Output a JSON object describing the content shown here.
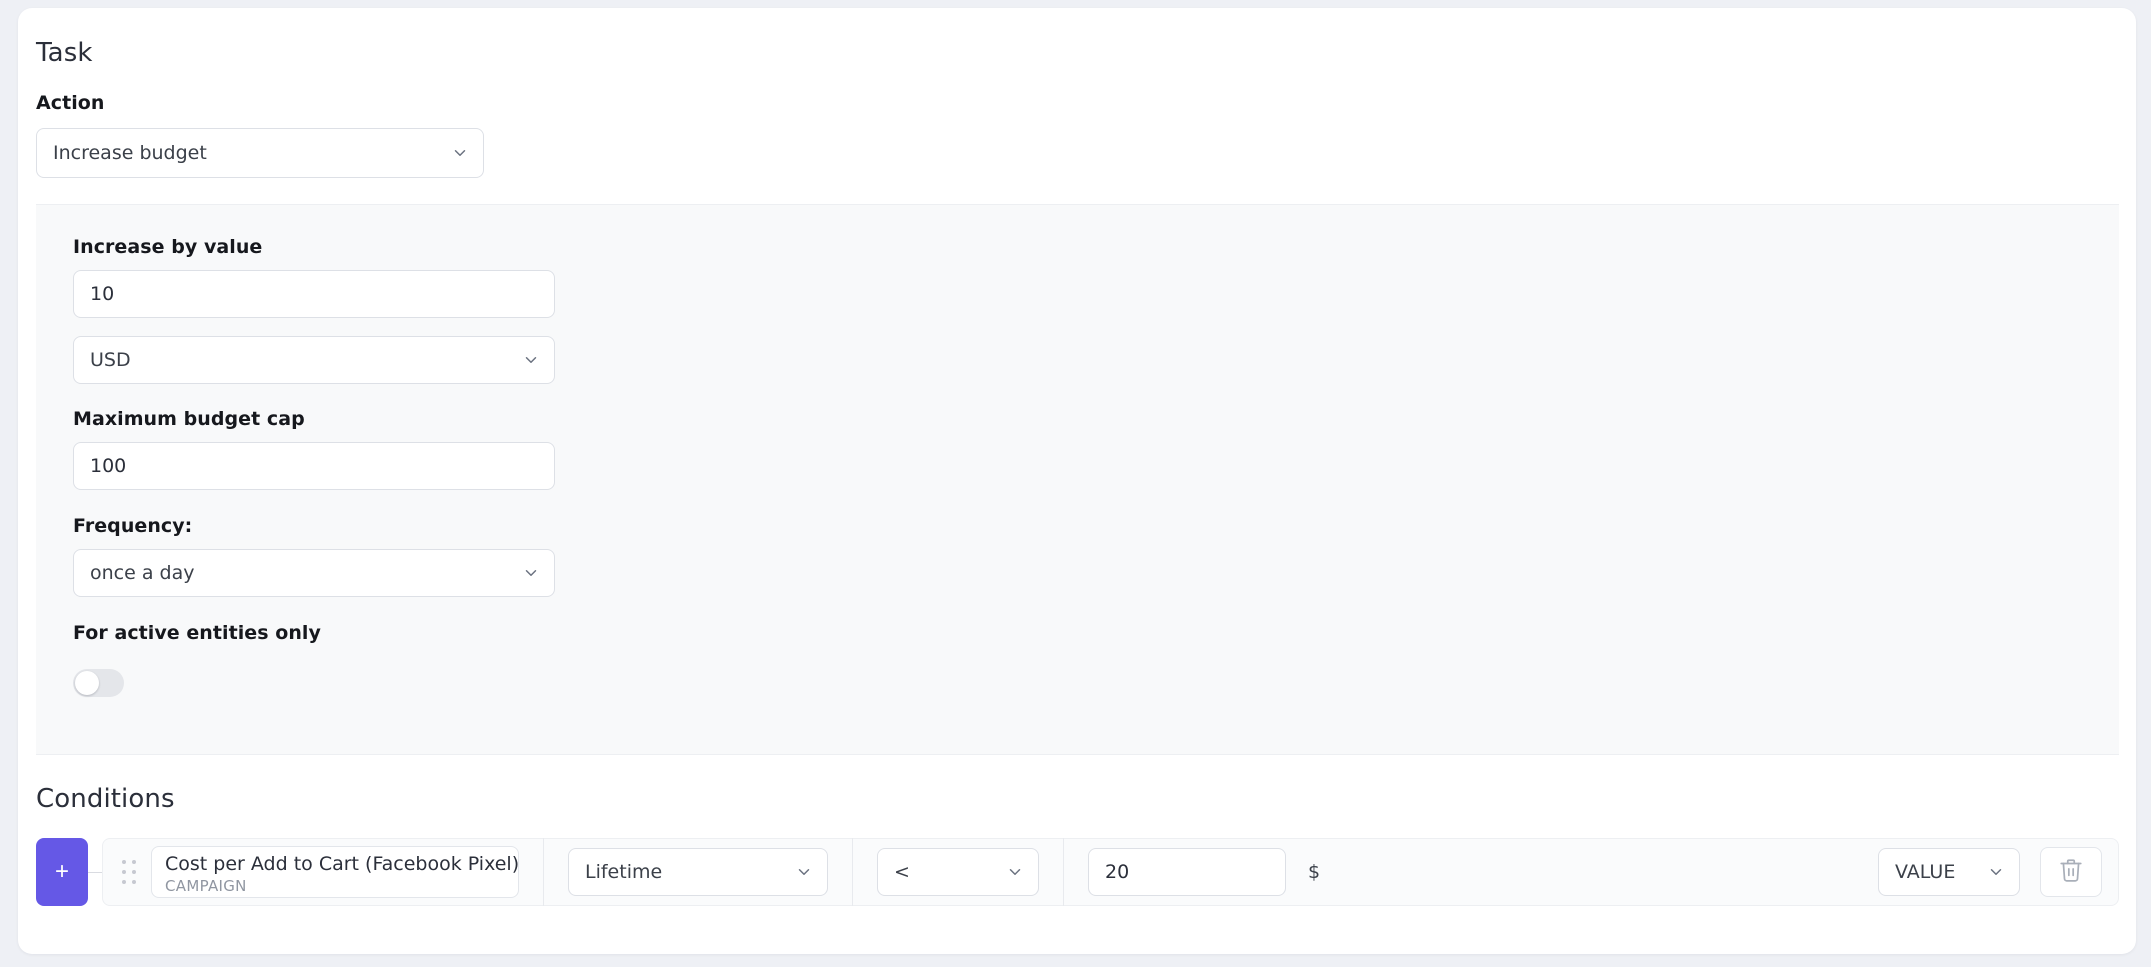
{
  "task": {
    "title": "Task",
    "action_label": "Action",
    "action_value": "Increase budget",
    "increase_by_label": "Increase by value",
    "increase_by_value": "10",
    "currency_value": "USD",
    "max_budget_cap_label": "Maximum budget cap",
    "max_budget_cap_value": "100",
    "frequency_label": "Frequency:",
    "frequency_value": "once a day",
    "active_entities_label": "For active entities only",
    "active_entities_on": false
  },
  "conditions": {
    "title": "Conditions",
    "add_label": "+",
    "rows": [
      {
        "drag_handle": "drag-handle",
        "metric_name": "Cost per Add to Cart (Facebook Pixel)",
        "metric_level": "CAMPAIGN",
        "period": "Lifetime",
        "operator": "<",
        "value": "20",
        "unit": "$",
        "value_type": "VALUE",
        "delete_label": "trash-icon"
      }
    ]
  },
  "colors": {
    "accent": "#6558E6",
    "page_bg": "#EEF0F5",
    "card_bg": "#FFFFFF",
    "panel_bg": "#F8F9FA",
    "border": "#DDE0E6",
    "text": "#2B2F3A",
    "muted": "#9096A1"
  }
}
